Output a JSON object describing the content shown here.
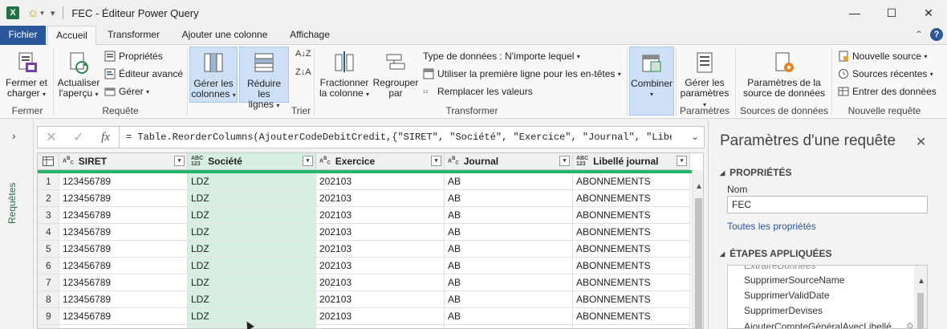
{
  "window": {
    "title": "FEC - Éditeur Power Query",
    "excel_glyph": "X",
    "quick_access": [
      "smiley-icon",
      "customize-icon"
    ]
  },
  "tabs": [
    {
      "label": "Fichier"
    },
    {
      "label": "Accueil"
    },
    {
      "label": "Transformer"
    },
    {
      "label": "Ajouter une colonne"
    },
    {
      "label": "Affichage"
    }
  ],
  "ribbon": {
    "groups": {
      "fermer": "Fermer",
      "requete": "Requête",
      "trier": "Trier",
      "transformer": "Transformer",
      "parametres": "Paramètres",
      "sources": "Sources de données",
      "nouvelle": "Nouvelle requête"
    },
    "fermer_charger": {
      "line1": "Fermer et",
      "line2": "charger"
    },
    "actualiser": {
      "line1": "Actualiser",
      "line2": "l'aperçu"
    },
    "proprietes": "Propriétés",
    "editeur_avance": "Éditeur avancé",
    "gerer": "Gérer",
    "gerer_colonnes": {
      "line1": "Gérer les",
      "line2": "colonnes"
    },
    "reduire_lignes": {
      "line1": "Réduire les",
      "line2": "lignes"
    },
    "fractionner": {
      "line1": "Fractionner",
      "line2": "la colonne"
    },
    "regrouper": {
      "line1": "Regrouper",
      "line2": "par"
    },
    "type_donnees": "Type de données : N'importe lequel",
    "premiere_ligne": "Utiliser la première ligne pour les en-têtes",
    "remplacer": "Remplacer les valeurs",
    "combiner": "Combiner",
    "gerer_parametres": {
      "line1": "Gérer les",
      "line2": "paramètres"
    },
    "parametres_source": {
      "line1": "Paramètres de la",
      "line2": "source de données"
    },
    "nouvelle_source": "Nouvelle source",
    "sources_recentes": "Sources récentes",
    "entrer_donnees": "Entrer des données"
  },
  "left_pane": {
    "label": "Requêtes"
  },
  "formula": "= Table.ReorderColumns(AjouterCodeDebitCredit,{\"SIRET\", \"Société\", \"Exercice\", \"Journal\", \"Libellé",
  "grid": {
    "columns": [
      {
        "name": "SIRET",
        "type": "ABC"
      },
      {
        "name": "Société",
        "type": "ABC123"
      },
      {
        "name": "Exercice",
        "type": "ABC"
      },
      {
        "name": "Journal",
        "type": "ABC"
      },
      {
        "name": "Libellé journal",
        "type": "ABC123"
      }
    ],
    "rows": [
      [
        "1",
        "123456789",
        "LDZ",
        "202103",
        "AB",
        "ABONNEMENTS"
      ],
      [
        "2",
        "123456789",
        "LDZ",
        "202103",
        "AB",
        "ABONNEMENTS"
      ],
      [
        "3",
        "123456789",
        "LDZ",
        "202103",
        "AB",
        "ABONNEMENTS"
      ],
      [
        "4",
        "123456789",
        "LDZ",
        "202103",
        "AB",
        "ABONNEMENTS"
      ],
      [
        "5",
        "123456789",
        "LDZ",
        "202103",
        "AB",
        "ABONNEMENTS"
      ],
      [
        "6",
        "123456789",
        "LDZ",
        "202103",
        "AB",
        "ABONNEMENTS"
      ],
      [
        "7",
        "123456789",
        "LDZ",
        "202103",
        "AB",
        "ABONNEMENTS"
      ],
      [
        "8",
        "123456789",
        "LDZ",
        "202103",
        "AB",
        "ABONNEMENTS"
      ],
      [
        "9",
        "123456789",
        "LDZ",
        "202103",
        "AB",
        "ABONNEMENTS"
      ]
    ],
    "selected_column": "Société",
    "accent_color": "#24b56a",
    "selected_bg": "#d6efe0"
  },
  "settings": {
    "title": "Paramètres d'une requête",
    "properties_header": "PROPRIÉTÉS",
    "name_label": "Nom",
    "name_value": "FEC",
    "all_properties": "Toutes les propriétés",
    "steps_header": "ÉTAPES APPLIQUÉES",
    "steps": [
      "SupprimerSourceName",
      "SupprimerValidDate",
      "SupprimerDevises",
      "AjouterCompteGénéralAvecLibellé"
    ]
  },
  "colors": {
    "file_tab": "#2a579a",
    "excel_green": "#1e7145",
    "selected_ribbon": "#cde0f5"
  }
}
